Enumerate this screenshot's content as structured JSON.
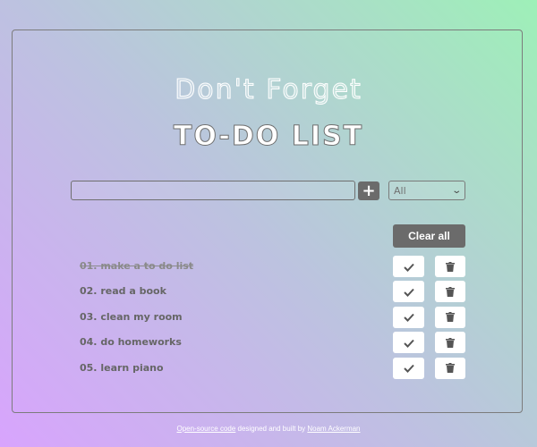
{
  "header": {
    "subtitle": "Don't Forget",
    "title": "TO-DO LIST"
  },
  "form": {
    "input_value": "",
    "add_icon": "plus-icon",
    "filter_selected": "All"
  },
  "actions": {
    "clear_all_label": "Clear all"
  },
  "todos": [
    {
      "number": "01.",
      "text": "make a to do list",
      "completed": true
    },
    {
      "number": "02.",
      "text": "read a book",
      "completed": false
    },
    {
      "number": "03.",
      "text": "clean my room",
      "completed": false
    },
    {
      "number": "04.",
      "text": "do homeworks",
      "completed": false
    },
    {
      "number": "05.",
      "text": "learn piano",
      "completed": false
    }
  ],
  "icons": {
    "check": "check-icon",
    "trash": "trash-icon"
  },
  "footer": {
    "link_source": "Open-source code",
    "middle_text": " designed and built by ",
    "link_author": "Noam Ackerman"
  },
  "colors": {
    "gradient_start": "#d8a4fd",
    "gradient_end": "#9ef0b8",
    "button_dark": "#6b6b6b",
    "text_muted": "#666666"
  }
}
